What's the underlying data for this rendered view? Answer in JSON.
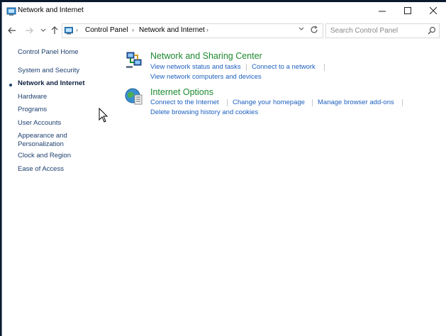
{
  "window": {
    "title": "Network and Internet"
  },
  "address_bar": {
    "crumbs": [
      "Control Panel",
      "Network and Internet"
    ],
    "separator": "›"
  },
  "search": {
    "placeholder": "Search Control Panel"
  },
  "sidebar": {
    "home": "Control Panel Home",
    "items": [
      {
        "label": "System and Security",
        "active": false
      },
      {
        "label": "Network and Internet",
        "active": true
      },
      {
        "label": "Hardware",
        "active": false
      },
      {
        "label": "Programs",
        "active": false
      },
      {
        "label": "User Accounts",
        "active": false
      },
      {
        "label": "Appearance and",
        "label2": "Personalization",
        "active": false
      },
      {
        "label": "Clock and Region",
        "active": false
      },
      {
        "label": "Ease of Access",
        "active": false
      }
    ]
  },
  "categories": [
    {
      "title": "Network and Sharing Center",
      "icon": "network-sharing-icon",
      "links_row1": [
        "View network status and tasks",
        "Connect to a network"
      ],
      "links_row2": [
        "View network computers and devices"
      ]
    },
    {
      "title": "Internet Options",
      "icon": "internet-options-icon",
      "links_row1": [
        "Connect to the Internet",
        "Change your homepage",
        "Manage browser add-ons"
      ],
      "links_row2": [
        "Delete browsing history and cookies"
      ]
    }
  ],
  "colors": {
    "category_title": "#1c8a2e",
    "link": "#1c5fbf",
    "sidebar_link": "#1c3f6e"
  }
}
